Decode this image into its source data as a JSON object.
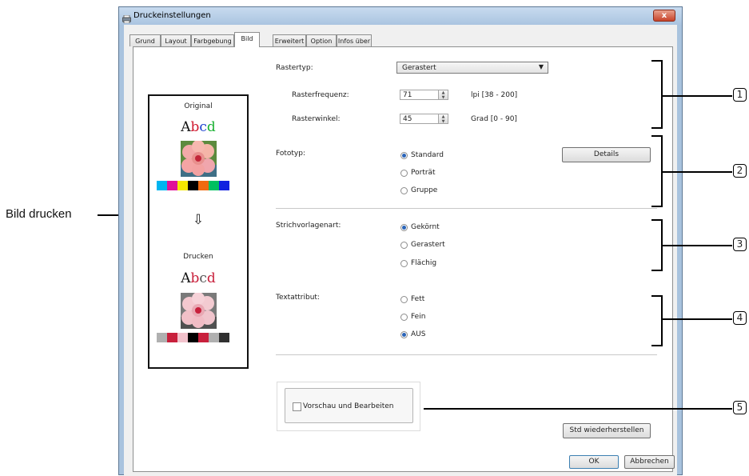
{
  "window": {
    "title": "Druckeinstellungen",
    "close_glyph": "x"
  },
  "tabs": [
    "Grund",
    "Layout",
    "Farbgebung",
    "Bild",
    "Erweitert",
    "Option",
    "Infos über"
  ],
  "preview": {
    "original_label": "Original",
    "arrow": "⇩",
    "print_label": "Drucken",
    "sample_text": "Abcd",
    "original_swatches": [
      "#00b4f0",
      "#e0119a",
      "#f5e800",
      "#000000",
      "#f06a10",
      "#00c060",
      "#1020e0"
    ],
    "print_swatches": [
      "#b0b0b0",
      "#c8203c",
      "#f2c2cc",
      "#000000",
      "#c8203c",
      "#b0b0b0",
      "#303030"
    ]
  },
  "raster": {
    "type_label": "Rastertyp:",
    "type_value": "Gerastert",
    "freq_label": "Rasterfrequenz:",
    "freq_value": "71",
    "freq_range": "lpi [38 - 200]",
    "angle_label": "Rasterwinkel:",
    "angle_value": "45",
    "angle_range": "Grad [0 - 90]"
  },
  "photo": {
    "label": "Fototyp:",
    "options": [
      "Standard",
      "Porträt",
      "Gruppe"
    ],
    "selected": 0,
    "details_button": "Details"
  },
  "line_art": {
    "label": "Strichvorlagenart:",
    "options": [
      "Gekörnt",
      "Gerastert",
      "Flächig"
    ],
    "selected": 0
  },
  "text_attr": {
    "label": "Textattribut:",
    "options": [
      "Fett",
      "Fein",
      "AUS"
    ],
    "selected": 2
  },
  "preview_edit_label": "Vorschau und Bearbeiten",
  "buttons": {
    "restore": "Std wiederherstellen",
    "ok": "OK",
    "cancel": "Abbrechen"
  },
  "annotations": {
    "callout_left": "Bild drucken",
    "numbers": [
      "1",
      "2",
      "3",
      "4",
      "5"
    ]
  }
}
